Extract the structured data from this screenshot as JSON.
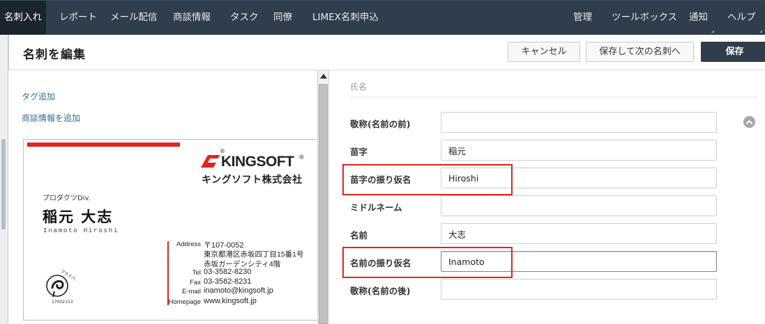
{
  "nav": {
    "left": [
      "名刺入れ",
      "レポート",
      "メール配信",
      "商談情報",
      "タスク",
      "同僚",
      "LIMEX名刺申込"
    ],
    "right": [
      "管理",
      "ツールボックス",
      "通知",
      "ヘルプ"
    ]
  },
  "header": {
    "title": "名刺を編集",
    "cancel": "キャンセル",
    "save_next": "保存して次の名刺へ",
    "save": "保存"
  },
  "left": {
    "add_tag": "タグ追加",
    "add_deal": "商談情報を追加"
  },
  "card": {
    "brand": "KINGSOFT",
    "reg_mark": "®",
    "company": "キングソフト株式会社",
    "department": "プロダクツDiv.",
    "name": "稲元 大志",
    "romaji": "Inamoto Hiroshi",
    "address_label": "Address",
    "address_lines": [
      "〒107-0052",
      "東京都港区赤坂四丁目15番1号",
      "赤坂ガーデンシティ4階"
    ],
    "tel_label": "Tel",
    "tel": "03-3582-8230",
    "fax_label": "Fax",
    "fax": "03-3582-8231",
    "email_label": "E-mail",
    "email": "inamoto@kingsoft.jp",
    "homepage_label": "Homepage",
    "homepage": "www.kingsoft.jp",
    "privacy_text": "プライバシー",
    "privacy_number": "17002153"
  },
  "form": {
    "section": "氏名",
    "fields": [
      {
        "label": "敬称(名前の前)",
        "value": ""
      },
      {
        "label": "苗字",
        "value": "稲元"
      },
      {
        "label": "苗字の振り仮名",
        "value": "Hiroshi"
      },
      {
        "label": "ミドルネーム",
        "value": ""
      },
      {
        "label": "名前",
        "value": "大志"
      },
      {
        "label": "名前の振り仮名",
        "value": "Inamoto"
      },
      {
        "label": "敬称(名前の後)",
        "value": ""
      }
    ]
  }
}
